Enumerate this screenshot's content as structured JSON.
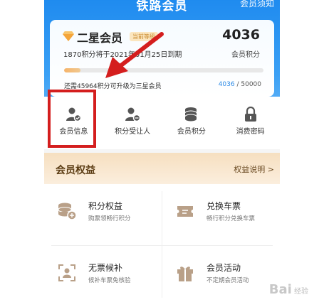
{
  "header": {
    "title": "铁路会员",
    "notice_link": "会员须知"
  },
  "member_card": {
    "level": "二星会员",
    "badge": "当前等级",
    "points": "4036",
    "points_label": "会员积分",
    "expire_text": "1870积分将于2021年01月25日到期",
    "upgrade_text": "还需45964积分可升级为三星会员",
    "progress_current": "4036",
    "progress_total": " / 50000",
    "progress_fraction": 0.081
  },
  "quick_actions": [
    {
      "label": "会员信息",
      "icon": "member-info-icon"
    },
    {
      "label": "积分受让人",
      "icon": "transferee-icon"
    },
    {
      "label": "会员积分",
      "icon": "points-stack-icon"
    },
    {
      "label": "消费密码",
      "icon": "lock-icon"
    }
  ],
  "rights": {
    "title": "会员权益",
    "link": "权益说明 >",
    "items": [
      {
        "title": "积分权益",
        "subtitle": "购票领畅行积分",
        "icon": "coins-icon"
      },
      {
        "title": "兑换车票",
        "subtitle": "畅行积分兑换车票",
        "icon": "ticket-icon"
      },
      {
        "title": "无票候补",
        "subtitle": "候补车票免核验",
        "icon": "scan-person-icon"
      },
      {
        "title": "会员活动",
        "subtitle": "不定期会员活动",
        "icon": "gift-icon"
      }
    ]
  },
  "watermark": {
    "brand": "Bai",
    "suffix": "经验"
  },
  "colors": {
    "header_blue": "#1f8bef",
    "annotation_red": "#d41e1e",
    "link_blue": "#2b8ae6"
  }
}
